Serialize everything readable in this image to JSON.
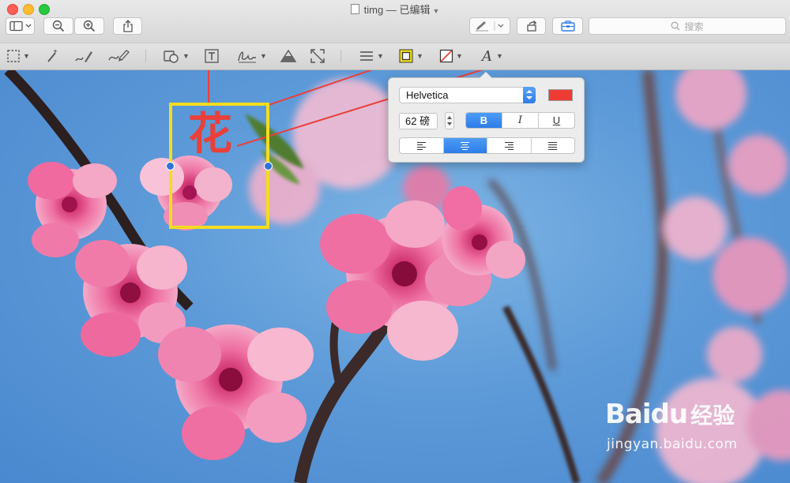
{
  "window": {
    "title": "timg",
    "title_separator": "—",
    "edited_status": "已编辑"
  },
  "toolbar": {
    "search_placeholder": "搜索",
    "items": [
      "sidebar-view",
      "zoom-out",
      "zoom-in",
      "share",
      "markup-pen",
      "rotate",
      "markup-toolbox"
    ]
  },
  "markup_tools": [
    "rectangular-selection",
    "instant-alpha",
    "sketch",
    "draw",
    "shapes",
    "text",
    "sign",
    "adjust-color",
    "adjust-size",
    "shape-style",
    "border-color",
    "fill-color",
    "text-style"
  ],
  "annotation": {
    "text": "花",
    "text_color": "#e9403a",
    "border_color": "#f5dc1e"
  },
  "text_popover": {
    "font_name": "Helvetica",
    "font_color": "#ee3b34",
    "font_size": "62 磅",
    "style_buttons": [
      "B",
      "I",
      "U"
    ],
    "active_style": "B",
    "alignments": [
      "left",
      "center",
      "right",
      "justify"
    ],
    "active_alignment": "center"
  },
  "watermark": {
    "logo_text": "Baidu",
    "logo_suffix": "经验",
    "url": "jingyan.baidu.com"
  }
}
